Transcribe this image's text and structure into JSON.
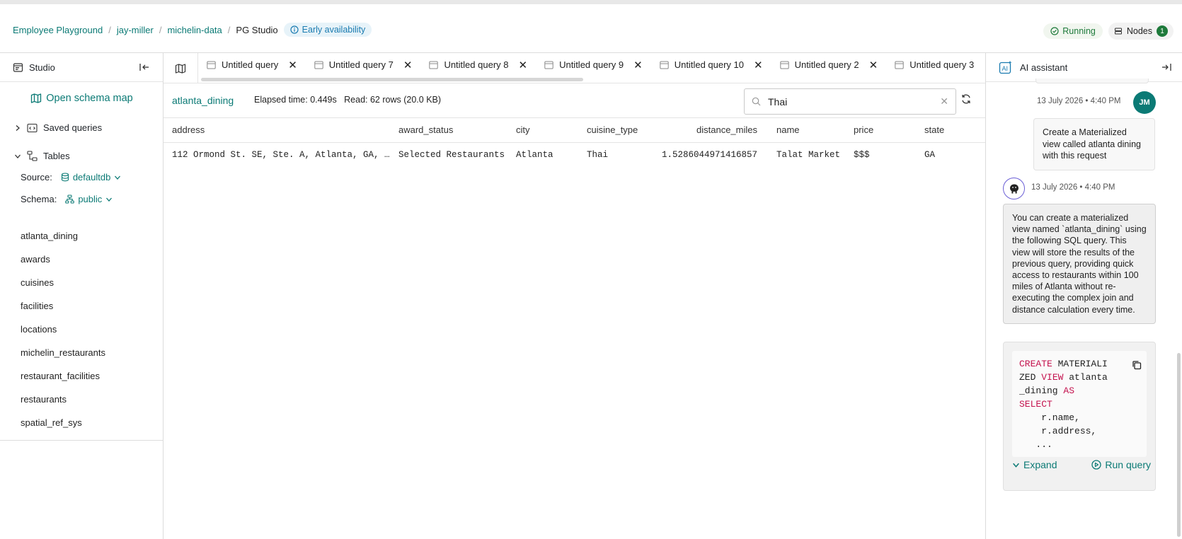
{
  "breadcrumb": {
    "items": [
      "Employee Playground",
      "jay-miller",
      "michelin-data"
    ],
    "current": "PG Studio",
    "badge": "Early availability"
  },
  "header_status": {
    "running": "Running",
    "nodes_label": "Nodes",
    "nodes_count": "1"
  },
  "sidebar": {
    "title": "Studio",
    "schema_map": "Open schema map",
    "saved_queries": "Saved queries",
    "tables_label": "Tables",
    "source_label": "Source:",
    "source_value": "defaultdb",
    "schema_label": "Schema:",
    "schema_value": "public",
    "tables": [
      "atlanta_dining",
      "awards",
      "cuisines",
      "facilities",
      "locations",
      "michelin_restaurants",
      "restaurant_facilities",
      "restaurants",
      "spatial_ref_sys"
    ]
  },
  "tabs": [
    "Untitled query",
    "Untitled query 7",
    "Untitled query 8",
    "Untitled query 9",
    "Untitled query 10",
    "Untitled query 2",
    "Untitled query 3"
  ],
  "result": {
    "table_name": "atlanta_dining",
    "meta": "Elapsed time: 0.449s   Read: 62 rows (20.0 KB)",
    "search_value": "Thai",
    "columns": [
      "address",
      "award_status",
      "city",
      "cuisine_type",
      "distance_miles",
      "name",
      "price",
      "state"
    ],
    "rows": [
      [
        "112 Ormond St. SE, Ste. A, Atlanta, GA, …",
        "Selected Restaurants",
        "Atlanta",
        "Thai",
        "1.5286044971416857",
        "Talat Market",
        "$$$",
        "GA"
      ]
    ]
  },
  "assistant": {
    "title": "AI assistant",
    "user_time": "13 July 2026 • 4:40 PM",
    "user_initials": "JM",
    "user_message": "Create a Materialized view called atlanta dining with this request",
    "ai_time": "13 July 2026 • 4:40 PM",
    "ai_message": "You can create a materialized view named `atlanta_dining` using the following SQL query. This view will store the results of the previous query, providing quick access to restaurants within 100 miles of Atlanta without re-executing the complex join and distance calculation every time.",
    "code": {
      "l1a": "CREATE",
      "l1b": " MATERIALI",
      "l2a": "ZED ",
      "l2b": "VIEW",
      "l2c": " atlanta",
      "l3a": "_dining ",
      "l3b": "AS",
      "l4": "SELECT",
      "l5": "    r.name,",
      "l6": "    r.address,",
      "l7": "   ..."
    },
    "expand": "Expand",
    "run_query": "Run query"
  },
  "colors": {
    "accent": "#0b7a75",
    "keyword": "#c4124e",
    "running": "#1e7a3b",
    "badge": "#1a7bb0"
  }
}
